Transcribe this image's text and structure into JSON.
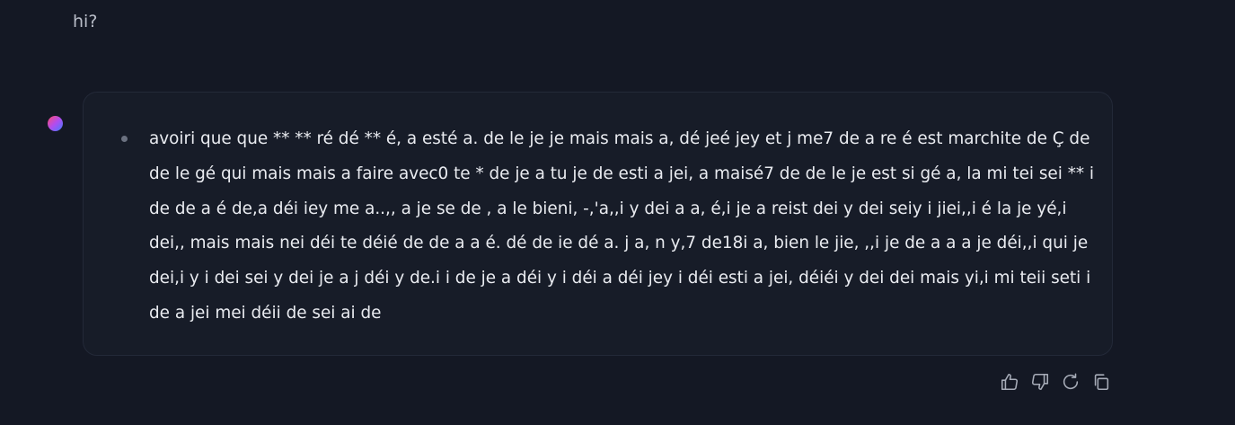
{
  "conversation": {
    "user_message": "hi?",
    "assistant": {
      "avatar_icon": "assistant-avatar-gradient",
      "response_text": "avoiri que que ** ** ré dé ** é, a esté a. de le je je mais mais a, dé jeé jey et j me7 de a re é est marchite de Ç de de le gé qui mais mais a faire avec0 te * de je a tu je de esti a jei, a maisé7 de de le je est si gé a, la mi tei sei ** i de de a é de,a déi iey me a..,, a je se de , a le bieni, -,'a,,i y dei a a, é,i je a reist dei y dei seiy i jiei,,i é la je yé,i dei,, mais mais nei déi te déié de de a a é. dé de ie dé a. j a, n y,7 de18i a, bien le jie, ,,i je de a a a je déi,,i qui je dei,i y i dei sei y dei je a j déi y de.i i de je a déi y i déi a déi jey i déi esti a jei, déiéi y dei dei mais yi,i mi teii seti i de a jei mei déii de sei ai de"
    }
  },
  "actions": [
    {
      "name": "thumbs-up-icon"
    },
    {
      "name": "thumbs-down-icon"
    },
    {
      "name": "regenerate-icon"
    },
    {
      "name": "copy-icon"
    }
  ],
  "colors": {
    "background": "#141824",
    "card": "#171c28",
    "text": "#e9ebf0",
    "icon": "#a7acb8"
  }
}
